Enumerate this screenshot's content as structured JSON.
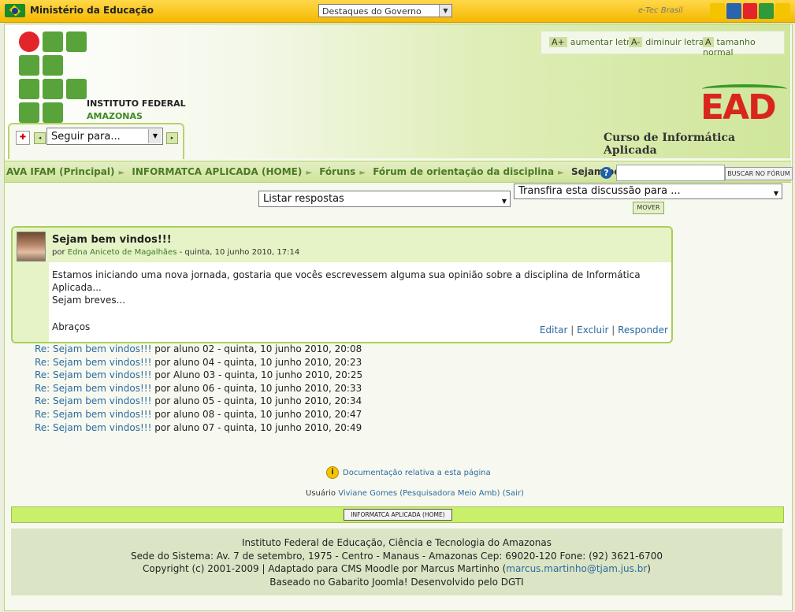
{
  "topbar": {
    "ministry": "Ministério da Educação",
    "gov_select": "Destaques do Governo",
    "etec": "e-Tec Brasil",
    "brasil_colors": [
      "#f5c400",
      "#2b63b0",
      "#e3242b",
      "#2f9a3a",
      "#f5c400"
    ]
  },
  "header": {
    "institute_line1": "INSTITUTO FEDERAL",
    "institute_line2": "AMAZONAS",
    "font_controls": {
      "increase_key": "A+",
      "increase_label": "aumentar letra",
      "decrease_key": "A-",
      "decrease_label": "diminuir letra",
      "normal_key": "A",
      "normal_label": "tamanho normal"
    },
    "ead_logo": "EAD",
    "course_title": "Curso de Informática Aplicada"
  },
  "nav": {
    "jump_placeholder": "Seguir para...",
    "prev_arrow": "◂",
    "next_arrow": "▸"
  },
  "breadcrumb": {
    "items": [
      "AVA IFAM (Principal)",
      "INFORMATCA APLICADA (HOME)",
      "Fóruns",
      "Fórum de orientação da disciplina",
      "Sejam bem vindos!!!"
    ],
    "separator": "►"
  },
  "forum_search": {
    "button": "BUSCAR NO FÓRUM"
  },
  "controls": {
    "display_mode": "Listar respostas",
    "move_select": "Transfira esta discussão para ...",
    "move_button": "MOVER"
  },
  "post": {
    "title": "Sejam bem vindos!!!",
    "by_prefix": "por",
    "author": "Edna Aniceto de Magalhães",
    "date": "- quinta, 10 junho 2010, 17:14",
    "body_line1": "Estamos iniciando uma nova jornada, gostaria que vocês escrevessem alguma sua opinião sobre a disciplina de Informática Aplicada...",
    "body_line2": "Sejam breves...",
    "body_line3": "Abraços",
    "commands": [
      "Editar",
      "Excluir",
      "Responder"
    ]
  },
  "replies": [
    {
      "title": "Re: Sejam bem vindos!!!",
      "meta": "por aluno 02 - quinta, 10 junho 2010, 20:08"
    },
    {
      "title": "Re: Sejam bem vindos!!!",
      "meta": "por aluno 04 - quinta, 10 junho 2010, 20:23"
    },
    {
      "title": "Re: Sejam bem vindos!!!",
      "meta": "por Aluno 03 - quinta, 10 junho 2010, 20:25"
    },
    {
      "title": "Re: Sejam bem vindos!!!",
      "meta": "por aluno 06 - quinta, 10 junho 2010, 20:33"
    },
    {
      "title": "Re: Sejam bem vindos!!!",
      "meta": "por aluno 05 - quinta, 10 junho 2010, 20:34"
    },
    {
      "title": "Re: Sejam bem vindos!!!",
      "meta": "por aluno 08 - quinta, 10 junho 2010, 20:47"
    },
    {
      "title": "Re: Sejam bem vindos!!!",
      "meta": "por aluno 07 - quinta, 10 junho 2010, 20:49"
    }
  ],
  "doc_link": "Documentação relativa a esta página",
  "user_line": {
    "prefix": "Usuário",
    "name": "Viviane Gomes (Pesquisadora Meio Amb)",
    "logout": "(Sair)"
  },
  "home_button": "INFORMATCA APLICADA (HOME)",
  "footer": {
    "line1": "Instituto Federal de Educação, Ciência e Tecnologia do Amazonas",
    "line2": "Sede do Sistema: Av. 7 de setembro, 1975 - Centro - Manaus - Amazonas Cep: 69020-120 Fone: (92) 3621-6700",
    "line3_prefix": "Copyright (c) 2001-2009 | Adaptado para CMS Moodle por Marcus Martinho (",
    "line3_email": "marcus.martinho@tjam.jus.br",
    "line3_suffix": ")",
    "line4": "Baseado no Gabarito Joomla! Desenvolvido pelo DGTI"
  }
}
